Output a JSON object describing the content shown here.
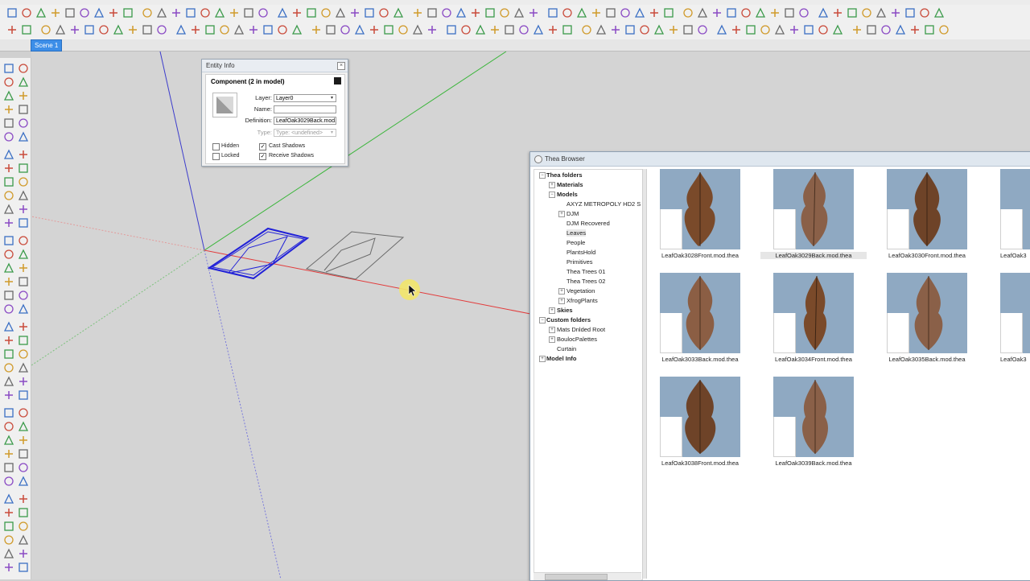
{
  "scene": {
    "tab_label": "Scene 1"
  },
  "entity_info": {
    "title": "Entity Info",
    "close_label": "×",
    "heading": "Component (2 in model)",
    "layer_label": "Layer:",
    "layer_value": "Layer0",
    "name_label": "Name:",
    "name_value": "",
    "definition_label": "Definition:",
    "definition_value": "LeafOak3029Back.mod.",
    "type_label": "Type:",
    "type_value": "Type: <undefined>",
    "hidden_label": "Hidden",
    "hidden_checked": false,
    "locked_label": "Locked",
    "locked_checked": false,
    "cast_shadows_label": "Cast Shadows",
    "cast_shadows_checked": true,
    "receive_shadows_label": "Receive Shadows",
    "receive_shadows_checked": true
  },
  "thea_browser": {
    "title": "Thea Browser",
    "tree": {
      "thea_folders": "Thea folders",
      "materials": "Materials",
      "models": "Models",
      "model_children": [
        "AXYZ METROPOLY HD2 S",
        "DJM",
        "DJM Recovered",
        "Leaves",
        "People",
        "PlantsHold",
        "Primitives",
        "Thea Trees 01",
        "Thea Trees 02",
        "Vegetation",
        "XfrogPlants"
      ],
      "skies": "Skies",
      "custom_folders": "Custom folders",
      "custom_children": [
        "Mats Dnlded Root",
        "BoulocPalettes",
        "Curtain"
      ],
      "model_info": "Model Info"
    },
    "thumbnails": [
      "LeafOak3028Front.mod.thea",
      "LeafOak3029Back.mod.thea",
      "LeafOak3030Front.mod.thea",
      "LeafOak3",
      "LeafOak3033Back.mod.thea",
      "LeafOak3034Front.mod.thea",
      "LeafOak3035Back.mod.thea",
      "LeafOak3",
      "LeafOak3038Front.mod.thea",
      "LeafOak3039Back.mod.thea"
    ],
    "selected_thumbnail": "LeafOak3029Back.mod.thea"
  },
  "colors": {
    "accent": "#3c8ee8",
    "axis_red": "#e23b3b",
    "axis_green": "#39b539",
    "axis_blue": "#3c3ccc",
    "selection_blue": "#2121d8",
    "thumb_bg": "#8fa9c2",
    "leaf_brown": "#7a4a2a"
  },
  "icons": [
    "select-icon",
    "eraser-icon",
    "pencil-icon",
    "rectangle-icon",
    "circle-icon",
    "arc-icon",
    "push-pull-icon",
    "move-icon",
    "rotate-icon",
    "scale-icon",
    "offset-icon",
    "tape-measure-icon",
    "protractor-icon",
    "text-icon",
    "orbit-icon",
    "pan-icon",
    "zoom-icon",
    "zoom-extents-icon",
    "walk-icon",
    "look-around-icon",
    "paint-bucket-icon",
    "component-icon",
    "section-icon"
  ]
}
